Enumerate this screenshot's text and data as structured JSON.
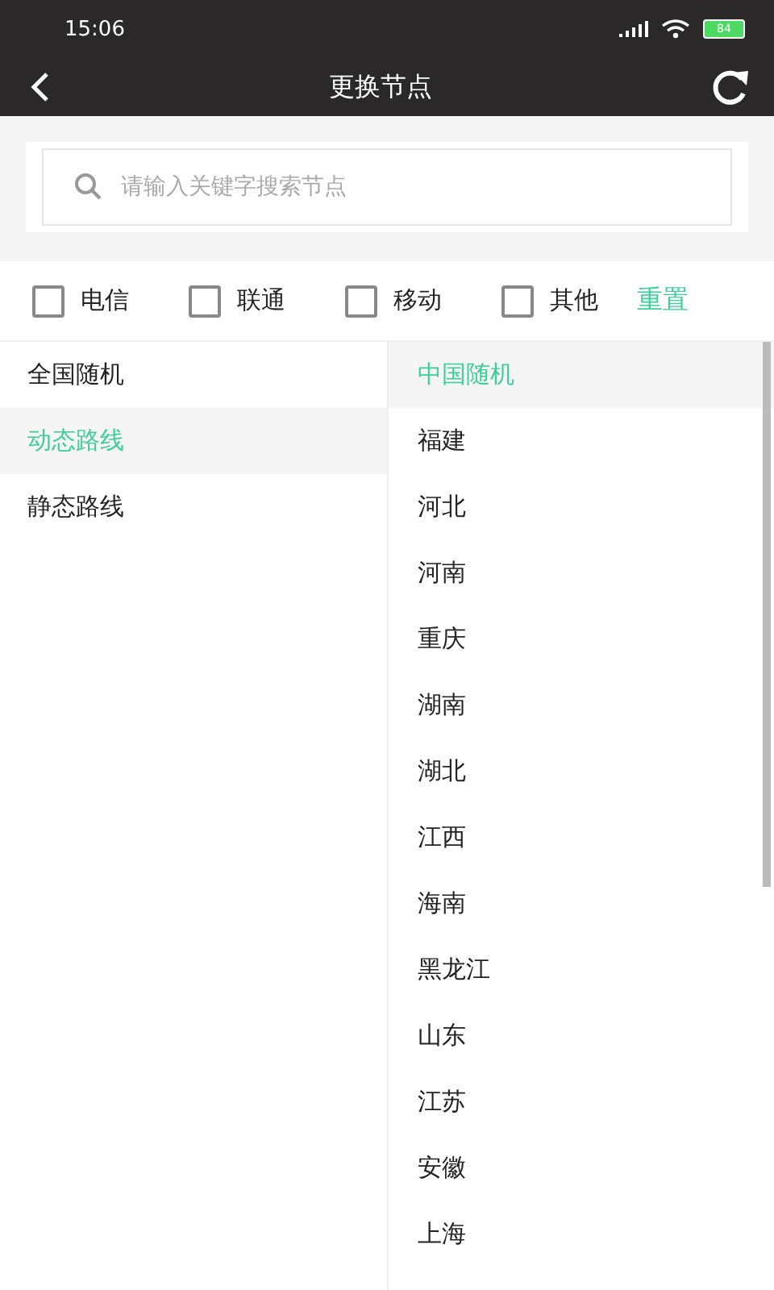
{
  "status_bar": {
    "time": "15:06",
    "battery": "84"
  },
  "header": {
    "title": "更换节点"
  },
  "search": {
    "placeholder": "请输入关键字搜索节点"
  },
  "filters": [
    {
      "label": "电信",
      "checked": false
    },
    {
      "label": "联通",
      "checked": false
    },
    {
      "label": "移动",
      "checked": false
    },
    {
      "label": "其他",
      "checked": false
    }
  ],
  "reset_label": "重置",
  "categories": [
    {
      "label": "全国随机",
      "selected": false
    },
    {
      "label": "动态路线",
      "selected": true
    },
    {
      "label": "静态路线",
      "selected": false
    }
  ],
  "regions": [
    {
      "label": "中国随机",
      "selected": true
    },
    {
      "label": "福建",
      "selected": false
    },
    {
      "label": "河北",
      "selected": false
    },
    {
      "label": "河南",
      "selected": false
    },
    {
      "label": "重庆",
      "selected": false
    },
    {
      "label": "湖南",
      "selected": false
    },
    {
      "label": "湖北",
      "selected": false
    },
    {
      "label": "江西",
      "selected": false
    },
    {
      "label": "海南",
      "selected": false
    },
    {
      "label": "黑龙江",
      "selected": false
    },
    {
      "label": "山东",
      "selected": false
    },
    {
      "label": "江苏",
      "selected": false
    },
    {
      "label": "安徽",
      "selected": false
    },
    {
      "label": "上海",
      "selected": false
    }
  ]
}
